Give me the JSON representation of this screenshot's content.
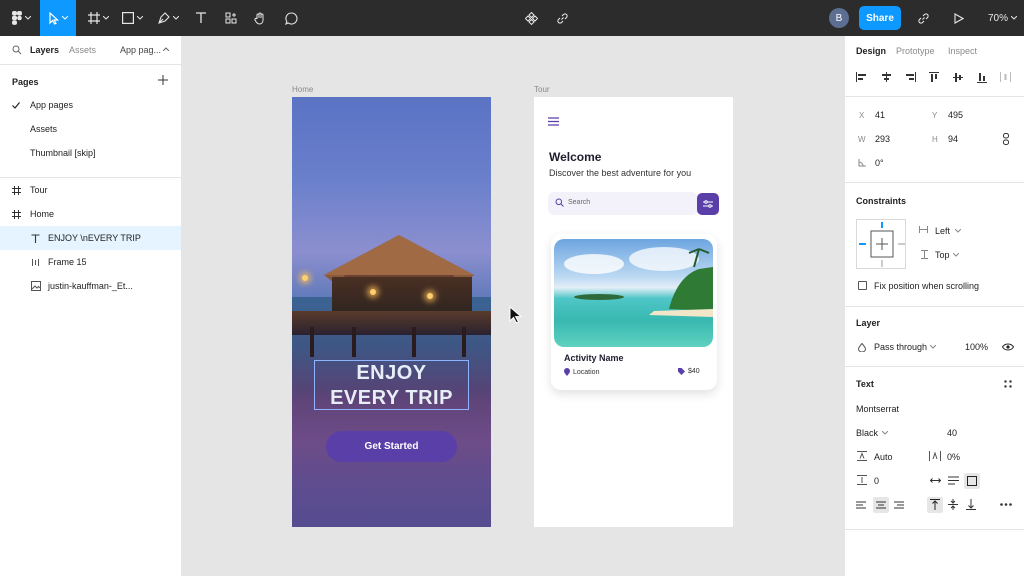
{
  "toolbar": {
    "share_label": "Share",
    "avatar_initial": "B",
    "zoom": "70%"
  },
  "left_panel": {
    "tabs": {
      "layers": "Layers",
      "assets": "Assets",
      "page_switch": "App pag..."
    },
    "pages_title": "Pages",
    "pages": [
      {
        "label": "App pages",
        "checked": true
      },
      {
        "label": "Assets",
        "checked": false
      },
      {
        "label": "Thumbnail [skip]",
        "checked": false
      }
    ],
    "layers": [
      {
        "label": "Tour",
        "icon": "frame-icon"
      },
      {
        "label": "Home",
        "icon": "frame-icon"
      },
      {
        "label": "ENJOY \\nEVERY TRIP",
        "icon": "text-icon",
        "selected": true
      },
      {
        "label": "Frame 15",
        "icon": "auto-layout-icon"
      },
      {
        "label": "justin-kauffman-_Et...",
        "icon": "image-icon"
      }
    ]
  },
  "canvas": {
    "home_frame": {
      "label": "Home",
      "hero_line1": "ENJOY",
      "hero_line2": "EVERY TRIP",
      "button": "Get Started"
    },
    "tour_frame": {
      "label": "Tour",
      "welcome": "Welcome",
      "subtitle": "Discover the best adventure for you",
      "search_placeholder": "Search",
      "card": {
        "title": "Activity Name",
        "location": "Location",
        "price": "$40"
      }
    }
  },
  "right_panel": {
    "tabs": {
      "design": "Design",
      "prototype": "Prototype",
      "inspect": "Inspect"
    },
    "position": {
      "x_label": "X",
      "x": "41",
      "y_label": "Y",
      "y": "495",
      "w_label": "W",
      "w": "293",
      "h_label": "H",
      "h": "94",
      "rotation": "0°"
    },
    "constraints": {
      "title": "Constraints",
      "horizontal": "Left",
      "vertical": "Top",
      "fix_label": "Fix position when scrolling"
    },
    "layer": {
      "title": "Layer",
      "blend": "Pass through",
      "opacity": "100%"
    },
    "text": {
      "title": "Text",
      "font": "Montserrat",
      "weight": "Black",
      "size": "40",
      "line_height": "Auto",
      "letter_spacing": "0%",
      "paragraph_spacing": "0"
    }
  },
  "colors": {
    "accent": "#0d99ff",
    "brand_purple": "#5a3fa8",
    "toolbar_bg": "#2c2c2c"
  }
}
